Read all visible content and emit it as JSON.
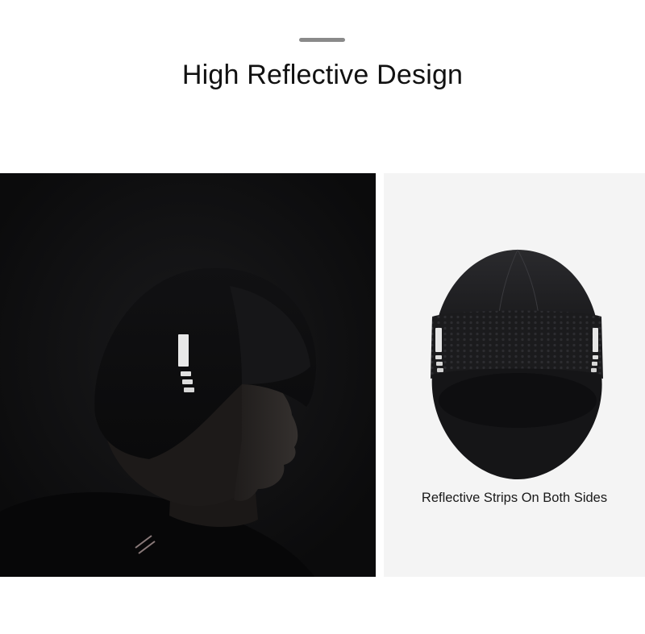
{
  "header": {
    "title": "High Reflective Design"
  },
  "product_view": {
    "caption": "Reflective Strips On Both Sides"
  },
  "colors": {
    "background": "#ffffff",
    "dark_panel": "#0c0c0d",
    "light_panel": "#f4f4f4",
    "reflective_strip": "#e8e8e8",
    "cap_fabric": "#141416"
  }
}
